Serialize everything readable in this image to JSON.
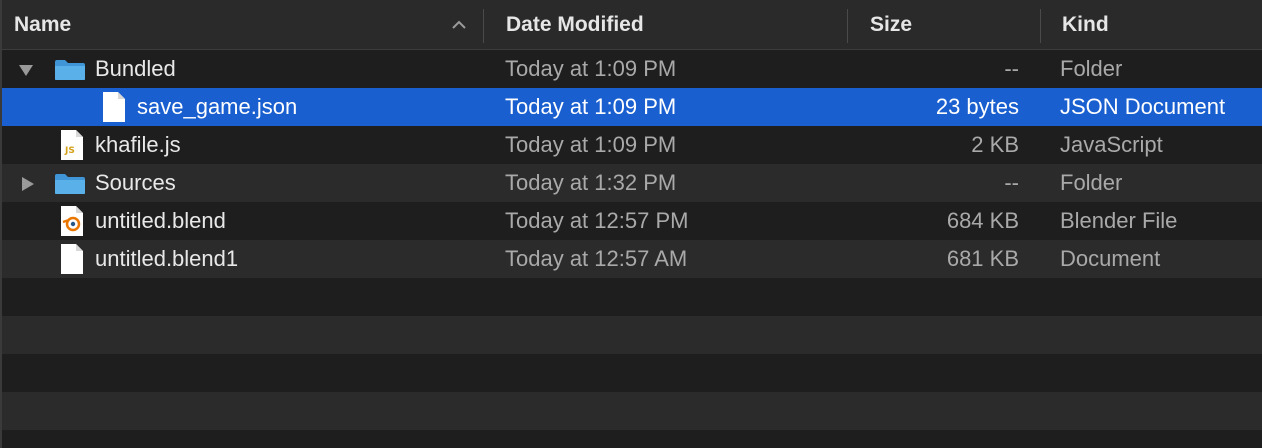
{
  "header": {
    "name": "Name",
    "date_modified": "Date Modified",
    "size": "Size",
    "kind": "Kind"
  },
  "colors": {
    "background": "#1e1e1e",
    "stripe": "#2b2b2b",
    "selection": "#1a5fcf",
    "folder": "#5ab0e8"
  },
  "files": [
    {
      "name": "Bundled",
      "date": "Today at 1:09 PM",
      "size": "--",
      "kind": "Folder",
      "icon": "folder-icon",
      "expanded": true,
      "selected": false
    },
    {
      "name": "save_game.json",
      "date": "Today at 1:09 PM",
      "size": "23 bytes",
      "kind": "JSON Document",
      "icon": "document-icon",
      "selected": true
    },
    {
      "name": "khafile.js",
      "date": "Today at 1:09 PM",
      "size": "2 KB",
      "kind": "JavaScript",
      "icon": "javascript-file-icon",
      "selected": false
    },
    {
      "name": "Sources",
      "date": "Today at 1:32 PM",
      "size": "--",
      "kind": "Folder",
      "icon": "folder-icon",
      "expanded": false,
      "selected": false
    },
    {
      "name": "untitled.blend",
      "date": "Today at 12:57 PM",
      "size": "684 KB",
      "kind": "Blender File",
      "icon": "blender-file-icon",
      "selected": false
    },
    {
      "name": "untitled.blend1",
      "date": "Today at 12:57 AM",
      "size": "681 KB",
      "kind": "Document",
      "icon": "document-icon",
      "selected": false
    }
  ]
}
